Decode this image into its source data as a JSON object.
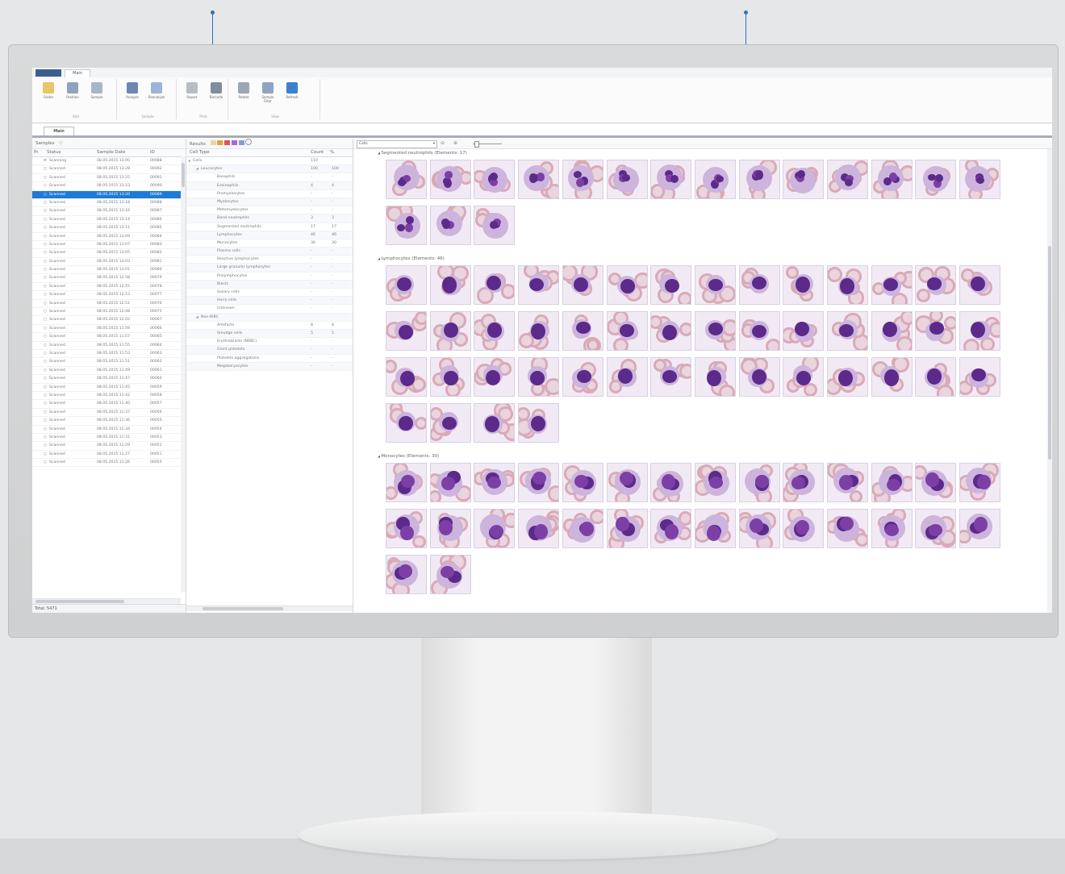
{
  "window": {
    "file_tab": "",
    "main_tab": "Main",
    "document_tab": "Main"
  },
  "ribbon": {
    "groups": [
      {
        "label": "Add",
        "buttons": [
          "Folder",
          "Position",
          "Sample"
        ]
      },
      {
        "label": "Sample",
        "buttons": [
          "Analyze",
          "Reanalyze"
        ]
      },
      {
        "label": "Print",
        "buttons": [
          "Report",
          "Barcode"
        ]
      },
      {
        "label": "View",
        "buttons": [
          "Rotate",
          "Sample Filter",
          "Refresh"
        ]
      }
    ]
  },
  "samples": {
    "header": "Samples",
    "columns": [
      "Pr.",
      "Status",
      "Sample Date",
      "ID"
    ],
    "rows": [
      {
        "status": "Scanning",
        "date": "08.05.2015 13:00",
        "id": "00088"
      },
      {
        "status": "Scanned",
        "date": "08.05.2015 13:28",
        "id": "00092"
      },
      {
        "status": "Scanned",
        "date": "08.05.2015 13:25",
        "id": "00091"
      },
      {
        "status": "Scanned",
        "date": "08.05.2015 13:23",
        "id": "00090"
      },
      {
        "status": "Scanned",
        "date": "08.05.2015 13:20",
        "id": "00089",
        "selected": true
      },
      {
        "status": "Scanned",
        "date": "08.05.2015 13:18",
        "id": "00088"
      },
      {
        "status": "Scanned",
        "date": "08.05.2015 13:16",
        "id": "00087"
      },
      {
        "status": "Scanned",
        "date": "08.05.2015 13:14",
        "id": "00086"
      },
      {
        "status": "Scanned",
        "date": "08.05.2015 13:11",
        "id": "00085"
      },
      {
        "status": "Scanned",
        "date": "08.05.2015 13:09",
        "id": "00084"
      },
      {
        "status": "Scanned",
        "date": "08.05.2015 13:07",
        "id": "00083"
      },
      {
        "status": "Scanned",
        "date": "08.05.2015 13:05",
        "id": "00082"
      },
      {
        "status": "Scanned",
        "date": "08.05.2015 13:03",
        "id": "00081"
      },
      {
        "status": "Scanned",
        "date": "08.05.2015 13:01",
        "id": "00080"
      },
      {
        "status": "Scanned",
        "date": "08.05.2015 12:58",
        "id": "00079"
      },
      {
        "status": "Scanned",
        "date": "08.05.2015 12:55",
        "id": "00078"
      },
      {
        "status": "Scanned",
        "date": "08.05.2015 12:53",
        "id": "00077"
      },
      {
        "status": "Scanned",
        "date": "08.05.2015 12:51",
        "id": "00076"
      },
      {
        "status": "Scanned",
        "date": "08.05.2015 12:48",
        "id": "00075"
      },
      {
        "status": "Scanned",
        "date": "08.05.2015 12:02",
        "id": "00067"
      },
      {
        "status": "Scanned",
        "date": "08.05.2015 11:59",
        "id": "00066"
      },
      {
        "status": "Scanned",
        "date": "08.05.2015 11:57",
        "id": "00065"
      },
      {
        "status": "Scanned",
        "date": "08.05.2015 11:55",
        "id": "00064"
      },
      {
        "status": "Scanned",
        "date": "08.05.2015 11:53",
        "id": "00063"
      },
      {
        "status": "Scanned",
        "date": "08.05.2015 11:51",
        "id": "00062"
      },
      {
        "status": "Scanned",
        "date": "08.05.2015 11:49",
        "id": "00061"
      },
      {
        "status": "Scanned",
        "date": "08.05.2015 11:47",
        "id": "00060"
      },
      {
        "status": "Scanned",
        "date": "08.05.2015 11:45",
        "id": "00059"
      },
      {
        "status": "Scanned",
        "date": "08.05.2015 11:42",
        "id": "00058"
      },
      {
        "status": "Scanned",
        "date": "08.05.2015 11:40",
        "id": "00057"
      },
      {
        "status": "Scanned",
        "date": "08.05.2015 11:37",
        "id": "00056"
      },
      {
        "status": "Scanned",
        "date": "08.05.2015 11:36",
        "id": "00055"
      },
      {
        "status": "Scanned",
        "date": "08.05.2015 11:34",
        "id": "00054"
      },
      {
        "status": "Scanned",
        "date": "08.05.2015 11:31",
        "id": "00053"
      },
      {
        "status": "Scanned",
        "date": "08.05.2015 11:29",
        "id": "00052"
      },
      {
        "status": "Scanned",
        "date": "08.05.2015 11:27",
        "id": "00051"
      },
      {
        "status": "Scanned",
        "date": "08.05.2015 11:26",
        "id": "00050"
      }
    ],
    "status_bar": "Total: 5471"
  },
  "results": {
    "header": "Results",
    "columns": [
      "Cell Type",
      "Count",
      "%"
    ],
    "rows": [
      {
        "indent": 0,
        "name": "Cells",
        "count": "110",
        "pct": "-"
      },
      {
        "indent": 1,
        "name": "Leucocytes",
        "count": "100",
        "pct": "100"
      },
      {
        "indent": 2,
        "name": "Basophils",
        "count": "-",
        "pct": "-"
      },
      {
        "indent": 2,
        "name": "Eosinophils",
        "count": "4",
        "pct": "4"
      },
      {
        "indent": 2,
        "name": "Promyelocytes",
        "count": "-",
        "pct": "-"
      },
      {
        "indent": 2,
        "name": "Myelocytes",
        "count": "-",
        "pct": "-"
      },
      {
        "indent": 2,
        "name": "Metamyelocytes",
        "count": "-",
        "pct": "-"
      },
      {
        "indent": 2,
        "name": "Band neutrophils",
        "count": "3",
        "pct": "3"
      },
      {
        "indent": 2,
        "name": "Segmented neutrophils",
        "count": "17",
        "pct": "17"
      },
      {
        "indent": 2,
        "name": "Lymphocytes",
        "count": "46",
        "pct": "46"
      },
      {
        "indent": 2,
        "name": "Monocytes",
        "count": "30",
        "pct": "30"
      },
      {
        "indent": 2,
        "name": "Plasma cells",
        "count": "-",
        "pct": "-"
      },
      {
        "indent": 2,
        "name": "Reactive lymphocytes",
        "count": "-",
        "pct": "-"
      },
      {
        "indent": 2,
        "name": "Large granular lymphocytes",
        "count": "-",
        "pct": "-"
      },
      {
        "indent": 2,
        "name": "Prolymphocytes",
        "count": "-",
        "pct": "-"
      },
      {
        "indent": 2,
        "name": "Blasts",
        "count": "-",
        "pct": "-"
      },
      {
        "indent": 2,
        "name": "Sezary cells",
        "count": "-",
        "pct": "-"
      },
      {
        "indent": 2,
        "name": "Hairy cells",
        "count": "-",
        "pct": "-"
      },
      {
        "indent": 2,
        "name": "Unknown",
        "count": "-",
        "pct": "-"
      },
      {
        "indent": 1,
        "name": "Non-WBC",
        "count": "",
        "pct": ""
      },
      {
        "indent": 2,
        "name": "Artefacts",
        "count": "8",
        "pct": "8"
      },
      {
        "indent": 2,
        "name": "Smudge cells",
        "count": "5",
        "pct": "5"
      },
      {
        "indent": 2,
        "name": "Erythroblasts (NRBC)",
        "count": "-",
        "pct": "-"
      },
      {
        "indent": 2,
        "name": "Giant platelets",
        "count": "-",
        "pct": "-"
      },
      {
        "indent": 2,
        "name": "Platelets aggregations",
        "count": "-",
        "pct": "-"
      },
      {
        "indent": 2,
        "name": "Megakaryocytes",
        "count": "-",
        "pct": "-"
      }
    ]
  },
  "cells_view": {
    "combo_value": "Cells",
    "sections": [
      {
        "title": "Segmented neutrophils (Elements: 17)",
        "count": 17,
        "type": "neutrophil"
      },
      {
        "title": "Lymphocytes (Elements: 46)",
        "count": 46,
        "type": "lymphocyte"
      },
      {
        "title": "Monocytes (Elements: 30)",
        "count": 30,
        "type": "monocyte"
      }
    ]
  },
  "colors": {
    "selection": "#1f7ad6",
    "callout": "#2f74b5",
    "nucleus": "#5b2a8a",
    "rbc": "#d8aab8"
  }
}
